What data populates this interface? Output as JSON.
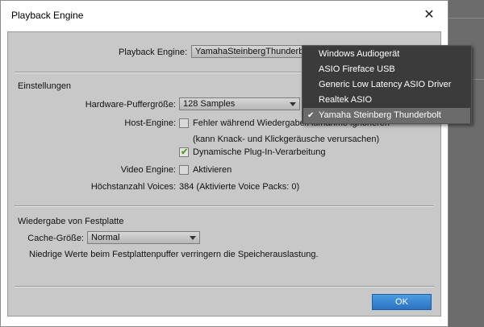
{
  "window": {
    "title": "Playback Engine",
    "close_symbol": "✕"
  },
  "engine": {
    "label": "Playback Engine:",
    "value": "YamahaSteinbergThunderbolt"
  },
  "dropdown": {
    "items": [
      {
        "label": "Windows Audiogerät",
        "selected": false
      },
      {
        "label": "ASIO Fireface USB",
        "selected": false
      },
      {
        "label": "Generic Low Latency ASIO Driver",
        "selected": false
      },
      {
        "label": "Realtek ASIO",
        "selected": false
      },
      {
        "label": "Yamaha Steinberg Thunderbolt",
        "selected": true
      }
    ],
    "check_symbol": "✔"
  },
  "settings": {
    "heading": "Einstellungen",
    "buffer_label": "Hardware-Puffergröße:",
    "buffer_value": "128 Samples",
    "host_label": "Host-Engine:",
    "host_text": "Fehler während Wiedergabe/Aufnahme ignorieren",
    "host_note": "(kann Knack- und Klickgeräusche verursachen)",
    "host_checked": false,
    "plugin_text": "Dynamische Plug-In-Verarbeitung",
    "plugin_checked": true,
    "video_label": "Video Engine:",
    "video_text": "Aktivieren",
    "video_checked": false,
    "voices_label": "Höchstanzahl Voices:",
    "voices_value": "384 (Aktivierte Voice Packs: 0)"
  },
  "disk": {
    "heading": "Wiedergabe von Festplatte",
    "cache_label": "Cache-Größe:",
    "cache_value": "Normal",
    "note": "Niedrige Werte beim Festplattenpuffer verringern die Speicherauslastung."
  },
  "ok_label": "OK",
  "colors": {
    "ok_button": "#2f7ccc",
    "menu_bg": "#3b3b3b",
    "menu_selected": "#6b6b6b",
    "checkbox_tick": "#5a9e12"
  }
}
